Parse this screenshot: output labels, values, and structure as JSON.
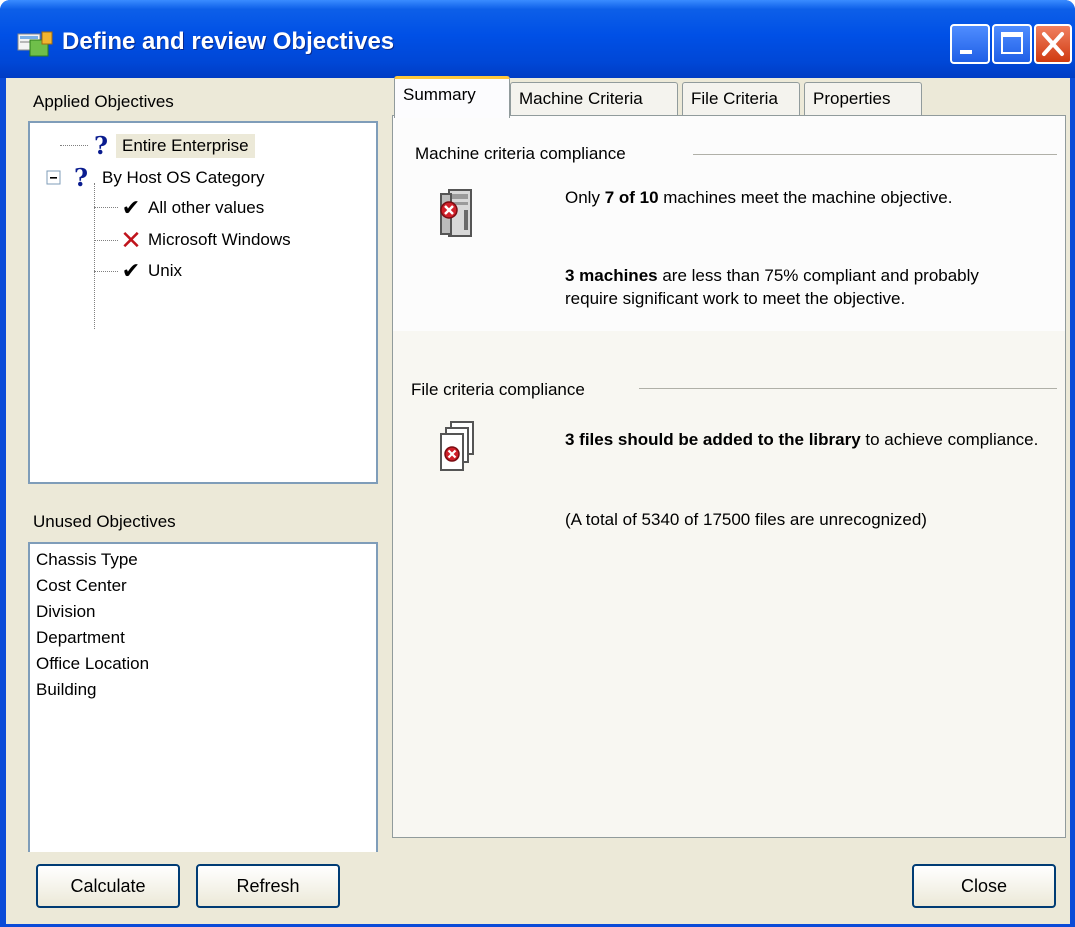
{
  "window": {
    "title": "Define and review Objectives"
  },
  "applied": {
    "label": "Applied Objectives",
    "items": [
      {
        "label": "Entire Enterprise",
        "status": "question",
        "level": 0,
        "selected": true
      },
      {
        "label": "By Host OS Category",
        "status": "question",
        "level": 0,
        "expanded": true
      },
      {
        "label": "All other values",
        "status": "check",
        "level": 1
      },
      {
        "label": "Microsoft Windows",
        "status": "cross",
        "level": 1
      },
      {
        "label": "Unix",
        "status": "check",
        "level": 1
      }
    ]
  },
  "unused": {
    "label": "Unused Objectives",
    "items": [
      "Chassis Type",
      "Cost Center",
      "Division",
      "Department",
      "Office Location",
      "Building"
    ]
  },
  "tabs": [
    "Summary",
    "Machine Criteria",
    "File Criteria",
    "Properties"
  ],
  "summary": {
    "machine": {
      "heading": "Machine criteria compliance",
      "p1_pre": "Only ",
      "p1_bold": "7 of 10",
      "p1_post": " machines meet the machine objective.",
      "p2_bold": "3 machines",
      "p2_post": " are less than 75% compliant and probably require significant work to meet the objective."
    },
    "files": {
      "heading": "File criteria compliance",
      "p1_bold": "3 files should be added to the library",
      "p1_post": " to achieve compliance.",
      "p2": "(A total of 5340 of 17500 files are unrecognized)"
    }
  },
  "buttons": {
    "calculate": "Calculate",
    "refresh": "Refresh",
    "close": "Close"
  }
}
